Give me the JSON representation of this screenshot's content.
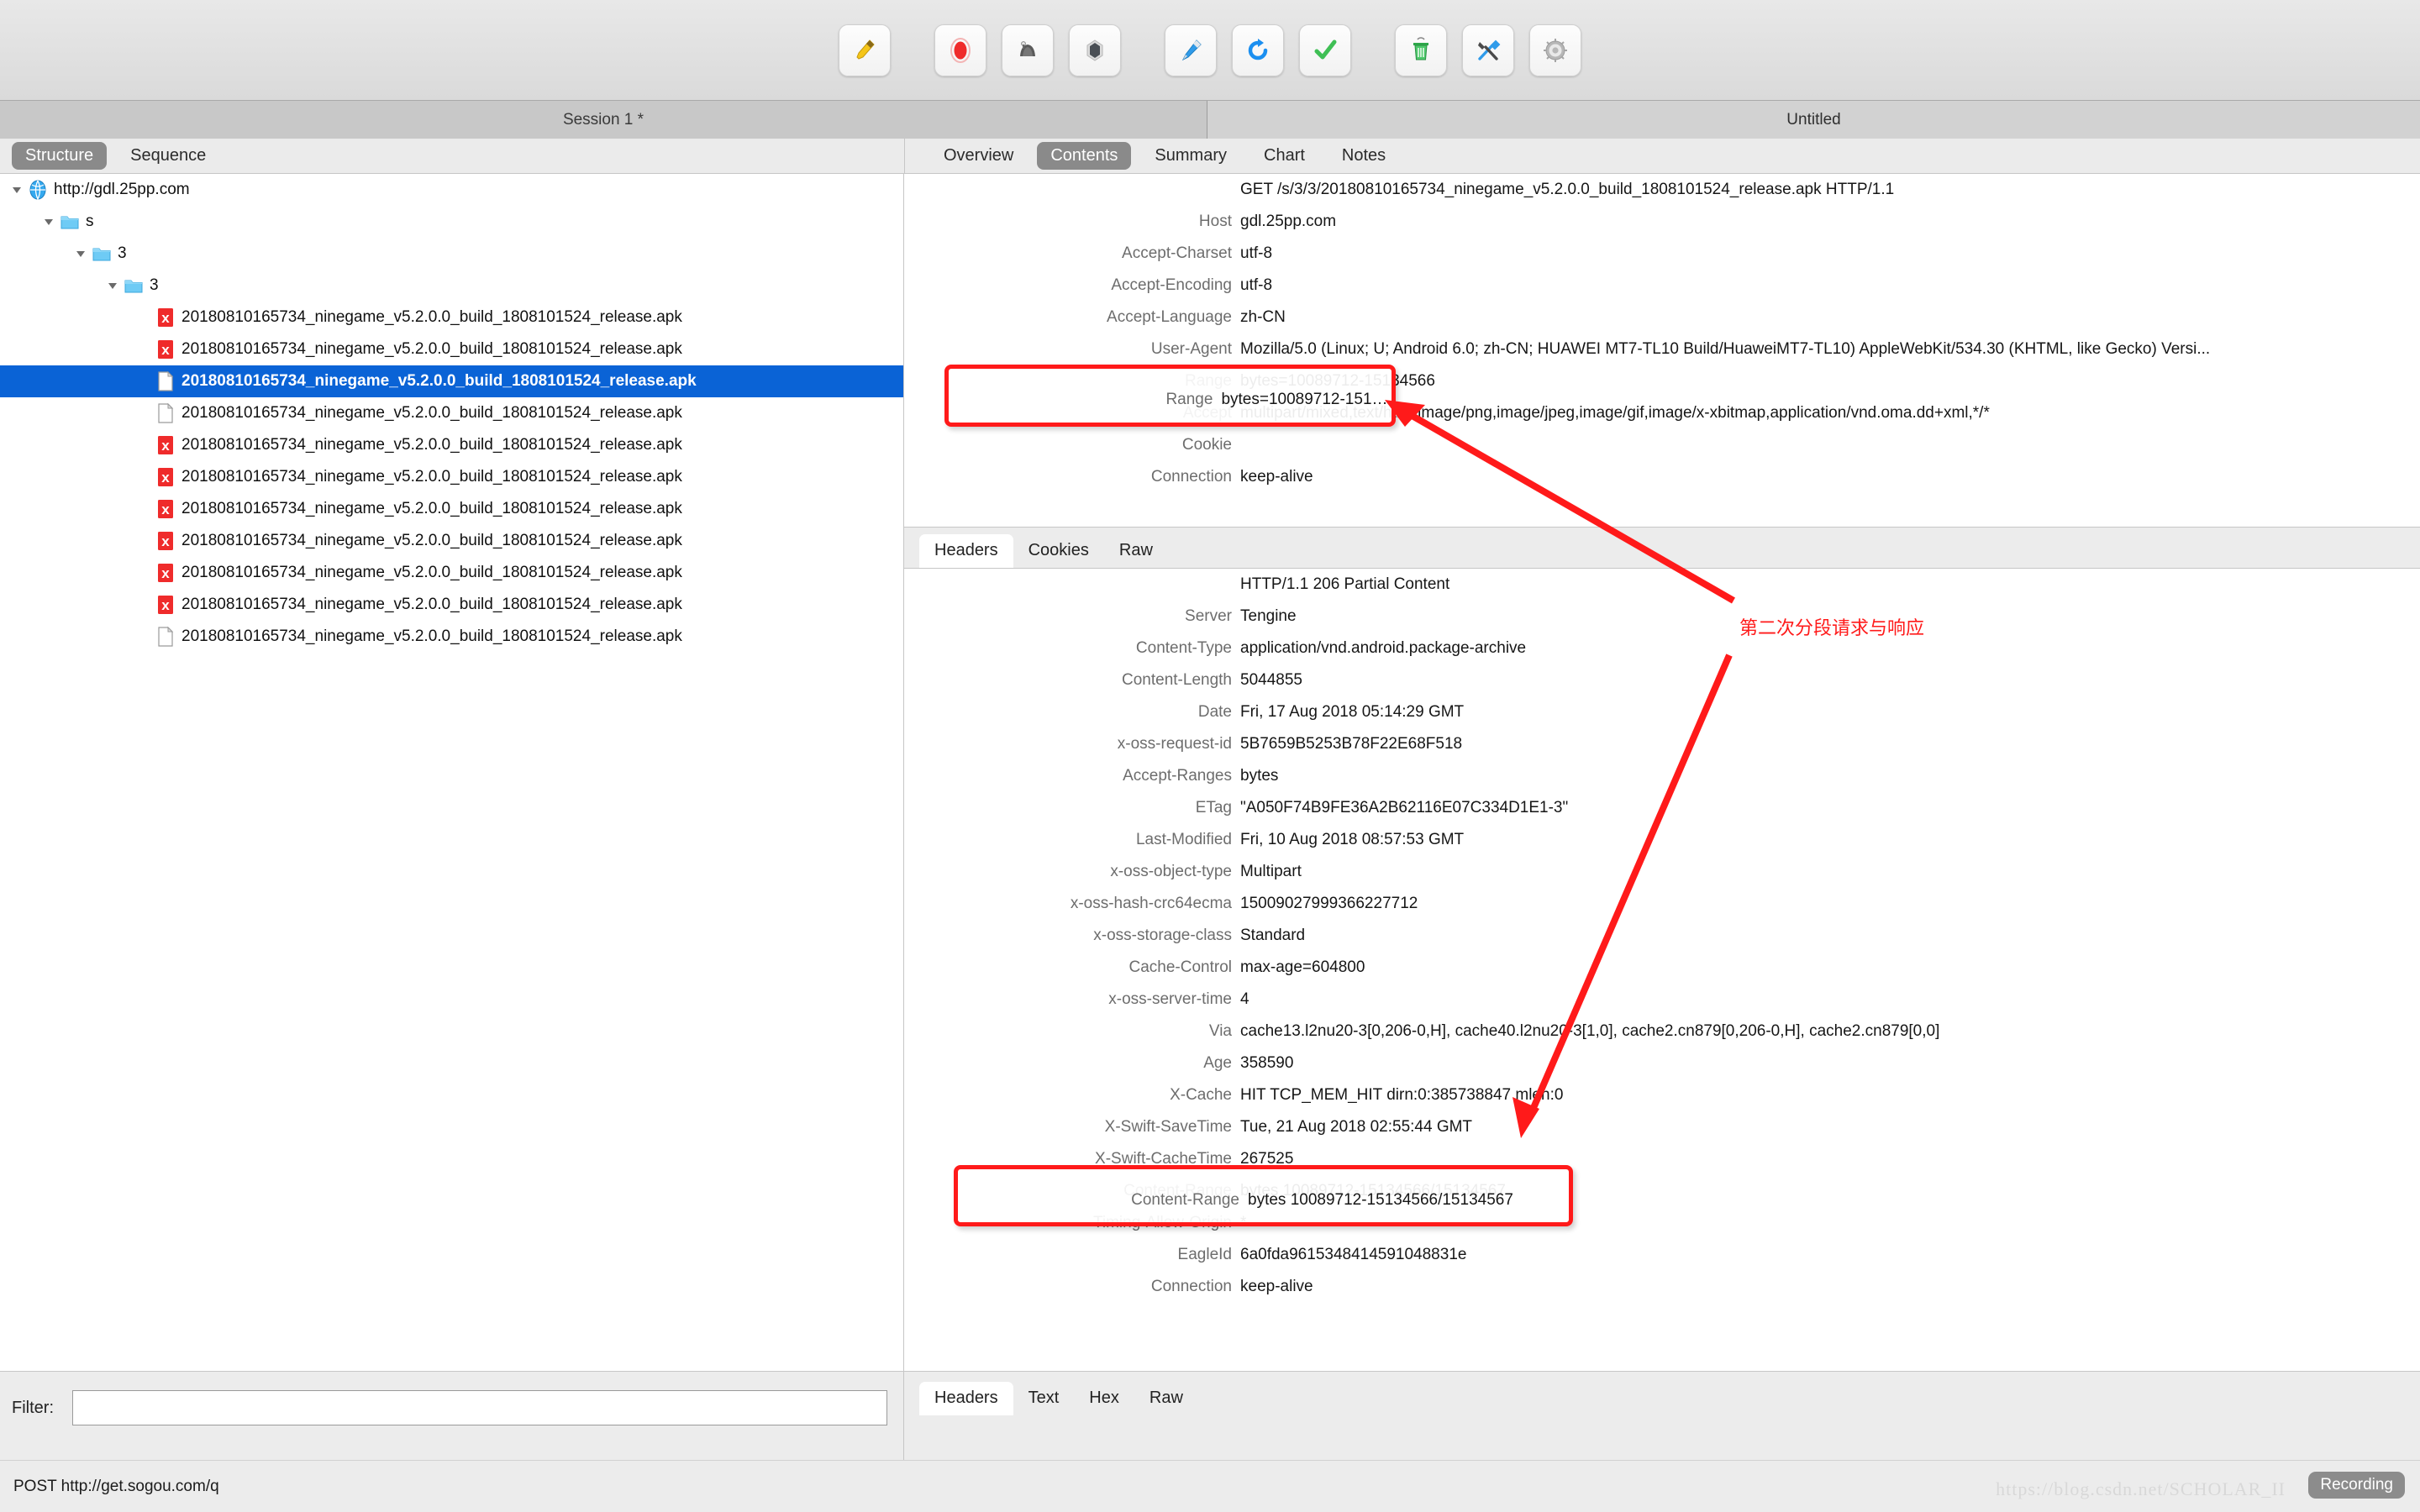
{
  "toolbar": {
    "buttons": [
      {
        "name": "clear-icon",
        "label": "Clear"
      },
      {
        "name": "record-icon",
        "label": "Start/Stop Recording"
      },
      {
        "name": "throttle-icon",
        "label": "Throttle Settings"
      },
      {
        "name": "breakpoint-icon",
        "label": "Breakpoints Settings"
      },
      {
        "name": "compose-icon",
        "label": "Compose"
      },
      {
        "name": "repeat-icon",
        "label": "Repeat"
      },
      {
        "name": "validate-icon",
        "label": "Validate"
      },
      {
        "name": "trash-icon",
        "label": "Clear Session"
      },
      {
        "name": "tools-icon",
        "label": "Tools"
      },
      {
        "name": "gear-icon",
        "label": "Settings"
      }
    ]
  },
  "session": {
    "left_title": "Session 1 *",
    "right_title": "Untitled"
  },
  "left_tabs": [
    {
      "label": "Structure",
      "active": true
    },
    {
      "label": "Sequence",
      "active": false
    }
  ],
  "right_tabs": [
    {
      "label": "Overview",
      "active": false
    },
    {
      "label": "Contents",
      "active": true
    },
    {
      "label": "Summary",
      "active": false
    },
    {
      "label": "Chart",
      "active": false
    },
    {
      "label": "Notes",
      "active": false
    }
  ],
  "tree": [
    {
      "indent": 0,
      "twisty": "down",
      "icon": "globe-icon",
      "label": "http://gdl.25pp.com",
      "selected": false
    },
    {
      "indent": 1,
      "twisty": "down",
      "icon": "folder-icon",
      "label": "s",
      "selected": false
    },
    {
      "indent": 2,
      "twisty": "down",
      "icon": "folder-icon",
      "label": "3",
      "selected": false
    },
    {
      "indent": 3,
      "twisty": "down",
      "icon": "folder-icon",
      "label": "3",
      "selected": false
    },
    {
      "indent": 4,
      "twisty": "none",
      "icon": "error-file-icon",
      "label": "20180810165734_ninegame_v5.2.0.0_build_1808101524_release.apk",
      "selected": false
    },
    {
      "indent": 4,
      "twisty": "none",
      "icon": "error-file-icon",
      "label": "20180810165734_ninegame_v5.2.0.0_build_1808101524_release.apk",
      "selected": false
    },
    {
      "indent": 4,
      "twisty": "none",
      "icon": "file-icon",
      "label": "20180810165734_ninegame_v5.2.0.0_build_1808101524_release.apk",
      "selected": true
    },
    {
      "indent": 4,
      "twisty": "none",
      "icon": "file-icon",
      "label": "20180810165734_ninegame_v5.2.0.0_build_1808101524_release.apk",
      "selected": false
    },
    {
      "indent": 4,
      "twisty": "none",
      "icon": "error-file-icon",
      "label": "20180810165734_ninegame_v5.2.0.0_build_1808101524_release.apk",
      "selected": false
    },
    {
      "indent": 4,
      "twisty": "none",
      "icon": "error-file-icon",
      "label": "20180810165734_ninegame_v5.2.0.0_build_1808101524_release.apk",
      "selected": false
    },
    {
      "indent": 4,
      "twisty": "none",
      "icon": "error-file-icon",
      "label": "20180810165734_ninegame_v5.2.0.0_build_1808101524_release.apk",
      "selected": false
    },
    {
      "indent": 4,
      "twisty": "none",
      "icon": "error-file-icon",
      "label": "20180810165734_ninegame_v5.2.0.0_build_1808101524_release.apk",
      "selected": false
    },
    {
      "indent": 4,
      "twisty": "none",
      "icon": "error-file-icon",
      "label": "20180810165734_ninegame_v5.2.0.0_build_1808101524_release.apk",
      "selected": false
    },
    {
      "indent": 4,
      "twisty": "none",
      "icon": "error-file-icon",
      "label": "20180810165734_ninegame_v5.2.0.0_build_1808101524_release.apk",
      "selected": false
    },
    {
      "indent": 4,
      "twisty": "none",
      "icon": "file-icon",
      "label": "20180810165734_ninegame_v5.2.0.0_build_1808101524_release.apk",
      "selected": false
    }
  ],
  "request": {
    "headers": [
      {
        "name": "",
        "value": "GET /s/3/3/20180810165734_ninegame_v5.2.0.0_build_1808101524_release.apk HTTP/1.1",
        "title": true
      },
      {
        "name": "Host",
        "value": "gdl.25pp.com"
      },
      {
        "name": "Accept-Charset",
        "value": "utf-8"
      },
      {
        "name": "Accept-Encoding",
        "value": "utf-8"
      },
      {
        "name": "Accept-Language",
        "value": "zh-CN"
      },
      {
        "name": "User-Agent",
        "value": "Mozilla/5.0 (Linux; U; Android 6.0; zh-CN; HUAWEI MT7-TL10 Build/HuaweiMT7-TL10) AppleWebKit/534.30 (KHTML, like Gecko) Versi..."
      },
      {
        "name": "Range",
        "value": "bytes=10089712-15134566"
      },
      {
        "name": "Accept",
        "value": "multipart/mixed,text/html,image/png,image/jpeg,image/gif,image/x-xbitmap,application/vnd.oma.dd+xml,*/*"
      },
      {
        "name": "Cookie",
        "value": ""
      },
      {
        "name": "Connection",
        "value": "keep-alive"
      }
    ]
  },
  "response_tabs": [
    {
      "label": "Headers",
      "active": true
    },
    {
      "label": "Cookies",
      "active": false
    },
    {
      "label": "Raw",
      "active": false
    }
  ],
  "response": {
    "headers": [
      {
        "name": "",
        "value": "HTTP/1.1 206 Partial Content",
        "title": true
      },
      {
        "name": "Server",
        "value": "Tengine"
      },
      {
        "name": "Content-Type",
        "value": "application/vnd.android.package-archive"
      },
      {
        "name": "Content-Length",
        "value": "5044855"
      },
      {
        "name": "Date",
        "value": "Fri, 17 Aug 2018 05:14:29 GMT"
      },
      {
        "name": "x-oss-request-id",
        "value": "5B7659B5253B78F22E68F518"
      },
      {
        "name": "Accept-Ranges",
        "value": "bytes"
      },
      {
        "name": "ETag",
        "value": "\"A050F74B9FE36A2B62116E07C334D1E1-3\""
      },
      {
        "name": "Last-Modified",
        "value": "Fri, 10 Aug 2018 08:57:53 GMT"
      },
      {
        "name": "x-oss-object-type",
        "value": "Multipart"
      },
      {
        "name": "x-oss-hash-crc64ecma",
        "value": "15009027999366227712"
      },
      {
        "name": "x-oss-storage-class",
        "value": "Standard"
      },
      {
        "name": "Cache-Control",
        "value": "max-age=604800"
      },
      {
        "name": "x-oss-server-time",
        "value": "4"
      },
      {
        "name": "Via",
        "value": "cache13.l2nu20-3[0,206-0,H], cache40.l2nu20-3[1,0], cache2.cn879[0,206-0,H], cache2.cn879[0,0]"
      },
      {
        "name": "Age",
        "value": "358590"
      },
      {
        "name": "X-Cache",
        "value": "HIT TCP_MEM_HIT dirn:0:385738847 mlen:0"
      },
      {
        "name": "X-Swift-SaveTime",
        "value": "Tue, 21 Aug 2018 02:55:44 GMT"
      },
      {
        "name": "X-Swift-CacheTime",
        "value": "267525"
      },
      {
        "name": "Content-Range",
        "value": "bytes 10089712-15134566/15134567"
      },
      {
        "name": "Timing-Allow-Origin",
        "value": "*"
      },
      {
        "name": "EagleId",
        "value": "6a0fda9615348414591048831e"
      },
      {
        "name": "Connection",
        "value": "keep-alive"
      }
    ]
  },
  "bottom_tabs": [
    {
      "label": "Headers",
      "active": true
    },
    {
      "label": "Text",
      "active": false
    },
    {
      "label": "Hex",
      "active": false
    },
    {
      "label": "Raw",
      "active": false
    }
  ],
  "filter": {
    "label": "Filter:",
    "value": "",
    "placeholder": ""
  },
  "status": {
    "text": "POST http://get.sogou.com/q",
    "recording_badge": "Recording",
    "watermark": "https://blog.csdn.net/SCHOLAR_II"
  },
  "annotations": {
    "note_text": "第二次分段请求与响应",
    "note_color": "#ff1a1a"
  }
}
